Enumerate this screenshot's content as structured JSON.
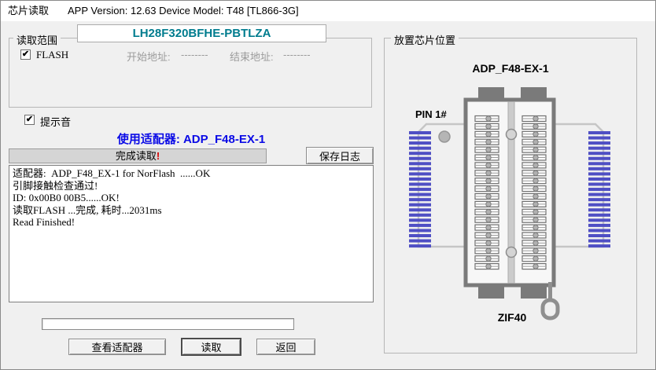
{
  "window": {
    "title": "芯片读取",
    "subtitle": "APP Version: 12.63 Device Model: T48 [TL866-3G]"
  },
  "icons": {
    "check_glyph": "✔"
  },
  "colors": {
    "chip_name_teal": "#007c8e",
    "adapter_text_blue": "#0a0ae6",
    "status_mark_red": "#d40000",
    "pin_blue": "#4f4fc4",
    "socket_gray": "#7a7a7a"
  },
  "left": {
    "group_title": "读取范围",
    "chip_name": "LH28F320BFHE-PBTLZA",
    "flash_label": "FLASH",
    "start_addr_label": "开始地址:",
    "start_addr_value": "--------",
    "end_addr_label": "结束地址:",
    "end_addr_value": "--------",
    "beep_label": "提示音",
    "adapter_line": "使用适配器: ADP_F48-EX-1",
    "status_text": "完成读取",
    "status_mark": "!",
    "save_log_button": "保存日志",
    "log_lines": [
      "适配器:  ADP_F48_EX-1 for NorFlash  ......OK",
      "引脚接触检查通过!",
      "ID: 0x00B0 00B5......OK!",
      "读取FLASH ...完成, 耗时...2031ms",
      "Read Finished!"
    ],
    "view_adapter_button": "查看适配器",
    "read_button": "读取",
    "back_button": "返回"
  },
  "right": {
    "group_title": "放置芯片位置",
    "adapter_label": "ADP_F48-EX-1",
    "pin1_label": "PIN 1#",
    "socket_label": "ZIF40",
    "socket": {
      "rows_per_side": 20,
      "comb_teeth": 23
    }
  }
}
